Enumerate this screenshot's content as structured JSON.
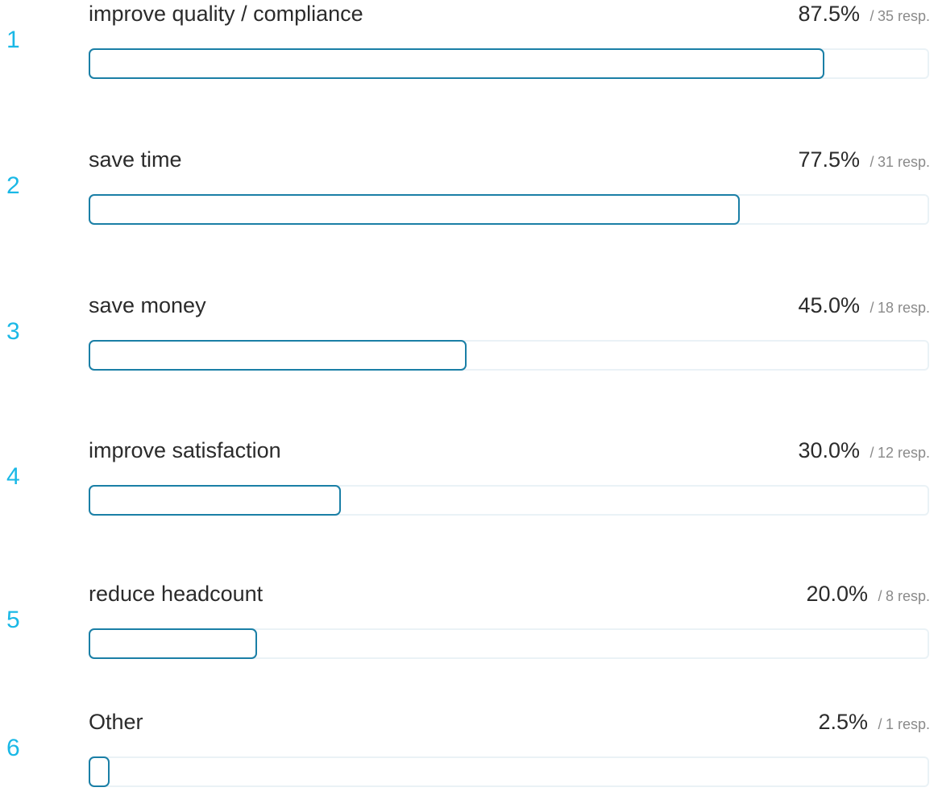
{
  "chart_data": {
    "type": "bar",
    "orientation": "horizontal",
    "xlim": [
      0,
      100
    ],
    "rows": [
      {
        "rank": "1",
        "label": "improve quality / compliance",
        "percent_text": "87.5%",
        "responses_text": "35 resp.",
        "value": 87.5,
        "responses": 35
      },
      {
        "rank": "2",
        "label": "save time",
        "percent_text": "77.5%",
        "responses_text": "31 resp.",
        "value": 77.5,
        "responses": 31
      },
      {
        "rank": "3",
        "label": "save money",
        "percent_text": "45.0%",
        "responses_text": "18 resp.",
        "value": 45.0,
        "responses": 18
      },
      {
        "rank": "4",
        "label": "improve satisfaction",
        "percent_text": "30.0%",
        "responses_text": "12 resp.",
        "value": 30.0,
        "responses": 12
      },
      {
        "rank": "5",
        "label": "reduce headcount",
        "percent_text": "20.0%",
        "responses_text": "8 resp.",
        "value": 20.0,
        "responses": 8
      },
      {
        "rank": "6",
        "label": "Other",
        "percent_text": "2.5%",
        "responses_text": "1 resp.",
        "value": 2.5,
        "responses": 1
      }
    ],
    "separator": "/",
    "colors": {
      "rank": "#1ab8e6",
      "bar_border": "#1a7fa6",
      "track_border": "#eaf2f6",
      "label": "#2b2b2b",
      "muted": "#8a8a8a"
    }
  }
}
